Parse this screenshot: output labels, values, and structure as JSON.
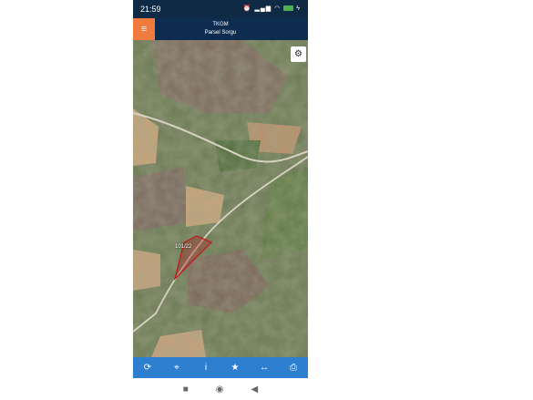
{
  "status": {
    "time": "21:59",
    "icons": [
      "alarm-icon",
      "signal-icon",
      "volte-icon",
      "signal-icon",
      "wifi-icon",
      "battery-icon",
      "charging-icon"
    ]
  },
  "appbar": {
    "title": "TKGM",
    "subtitle": "Parsel Sorgu",
    "menu_icon": "hamburger-icon"
  },
  "map": {
    "parcel_label": "101/22",
    "settings_icon": "gear-icon"
  },
  "toolbar": {
    "items": [
      "refresh-icon",
      "locate-icon",
      "info-icon",
      "star-icon",
      "measure-icon",
      "print-icon"
    ],
    "glyphs": [
      "⟳",
      "⌖",
      "i",
      "★",
      "↔",
      "⎙"
    ]
  },
  "navbar": {
    "glyphs": [
      "■",
      "◉",
      "◀"
    ]
  }
}
